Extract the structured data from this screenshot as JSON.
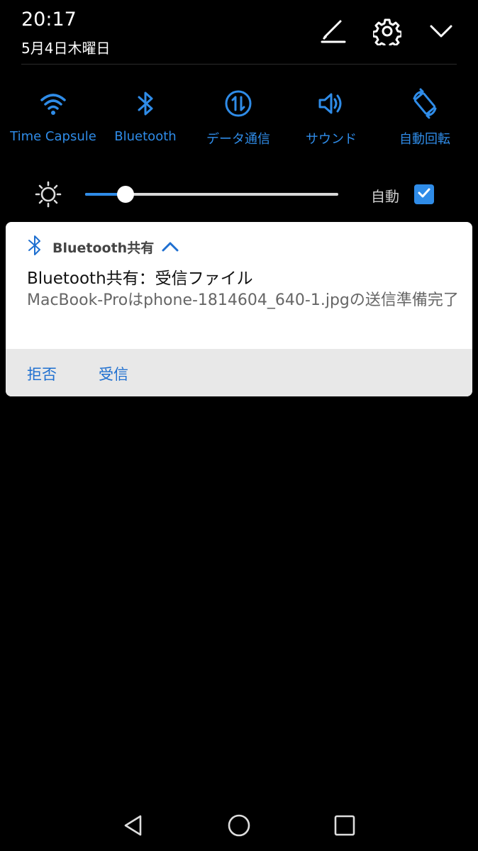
{
  "status": {
    "time": "20:17",
    "date": "5月4日木曜日"
  },
  "header_icons": {
    "edit": "edit-icon",
    "settings": "gear-icon",
    "collapse": "chevron-down-icon"
  },
  "tiles": [
    {
      "label": "Time Capsule",
      "icon": "wifi-icon"
    },
    {
      "label": "Bluetooth",
      "icon": "bluetooth-icon"
    },
    {
      "label": "データ通信",
      "icon": "data-transfer-icon"
    },
    {
      "label": "サウンド",
      "icon": "speaker-icon"
    },
    {
      "label": "自動回転",
      "icon": "auto-rotate-icon"
    }
  ],
  "brightness": {
    "level": 0.16,
    "auto_label": "自動",
    "auto_checked": true
  },
  "notification": {
    "app_name": "Bluetooth共有",
    "title": "Bluetooth共有：受信ファイル",
    "body": "MacBook-Proはphone-1814604_640-1.jpgの送信準備完了",
    "actions": {
      "reject": "拒否",
      "accept": "受信"
    }
  },
  "colors": {
    "accent": "#2f8ce8",
    "background": "#000000",
    "card": "#ffffff",
    "action_bar": "#e8e8e8"
  }
}
